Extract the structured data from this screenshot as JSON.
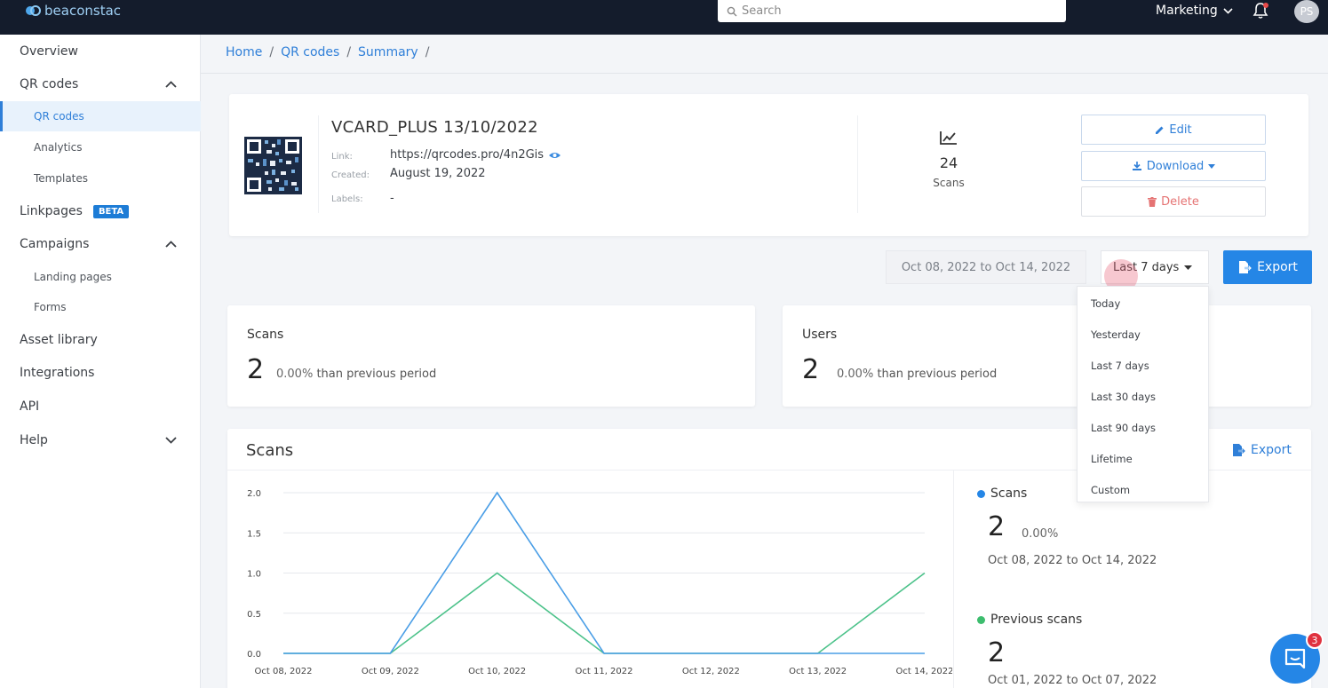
{
  "brand": {
    "name": "beaconstac"
  },
  "search": {
    "placeholder": "Search"
  },
  "workspace": {
    "label": "Marketing"
  },
  "user": {
    "initials": "PS"
  },
  "sidebar": {
    "overview": "Overview",
    "qr_codes": "QR codes",
    "qr_codes_sub": "QR codes",
    "analytics": "Analytics",
    "templates": "Templates",
    "linkpages": "Linkpages",
    "beta": "BETA",
    "campaigns": "Campaigns",
    "landing_pages": "Landing pages",
    "forms": "Forms",
    "asset_library": "Asset library",
    "integrations": "Integrations",
    "api": "API",
    "help": "Help"
  },
  "breadcrumb": [
    "Home",
    "QR codes",
    "Summary"
  ],
  "qr": {
    "title": "VCARD_PLUS 13/10/2022",
    "link_label": "Link:",
    "link": "https://qrcodes.pro/4n2Gis",
    "created_label": "Created:",
    "created": "August 19, 2022",
    "labels_label": "Labels:",
    "labels": "-",
    "scans_count": "24",
    "scans_label": "Scans",
    "edit": "Edit",
    "download": "Download",
    "delete": "Delete"
  },
  "filters": {
    "date_range": "Oct 08, 2022 to Oct 14, 2022",
    "selected": "Last 7 days",
    "export": "Export",
    "options": [
      "Today",
      "Yesterday",
      "Last 7 days",
      "Last 30 days",
      "Last 90 days",
      "Lifetime",
      "Custom"
    ]
  },
  "stats": {
    "scans": {
      "title": "Scans",
      "value": "2",
      "pct": "0.00%",
      "suffix": "than previous period"
    },
    "users": {
      "title": "Users",
      "value": "2",
      "pct": "0.00%",
      "suffix": "than previous period"
    }
  },
  "chart_card": {
    "title": "Scans",
    "export": "Export",
    "legend": {
      "current": {
        "name": "Scans",
        "value": "2",
        "pct": "0.00%",
        "range": "Oct 08, 2022 to Oct 14, 2022"
      },
      "previous": {
        "name": "Previous scans",
        "value": "2",
        "range": "Oct 01, 2022 to Oct 07, 2022"
      }
    }
  },
  "chat": {
    "badge": "3"
  },
  "colors": {
    "accent": "#2586e6",
    "series_current": "#4a9ee6",
    "series_previous": "#4cc28a"
  },
  "chart_data": {
    "type": "line",
    "categories": [
      "Oct 08, 2022",
      "Oct 09, 2022",
      "Oct 10, 2022",
      "Oct 11, 2022",
      "Oct 12, 2022",
      "Oct 13, 2022",
      "Oct 14, 2022"
    ],
    "series": [
      {
        "name": "Scans",
        "color": "#4a9ee6",
        "values": [
          0,
          0,
          2,
          0,
          0,
          0,
          0
        ]
      },
      {
        "name": "Previous scans",
        "color": "#4cc28a",
        "values": [
          0,
          0,
          1,
          0,
          0,
          0,
          1
        ]
      }
    ],
    "yticks": [
      "0.0",
      "0.5",
      "1.0",
      "1.5",
      "2.0"
    ],
    "ylim": [
      0,
      2
    ],
    "grid": true
  }
}
